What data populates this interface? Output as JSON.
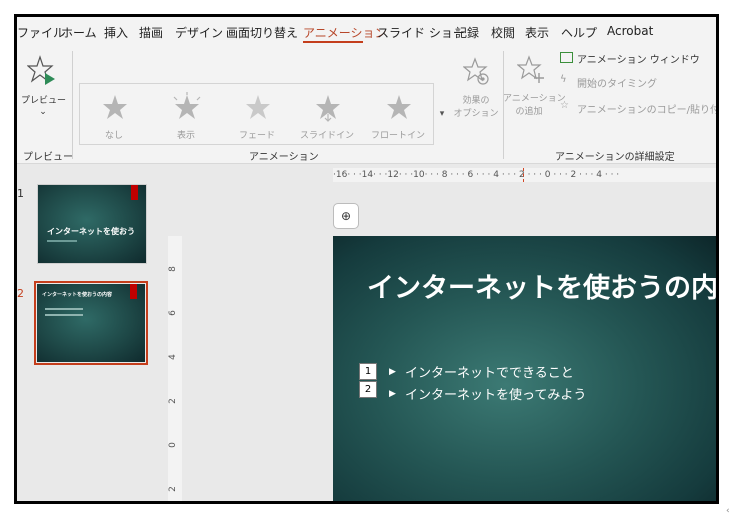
{
  "menu": {
    "items": [
      "ファイル",
      "ホーム",
      "挿入",
      "描画",
      "デザイン",
      "画面切り替え",
      "アニメーション",
      "スライド ショー",
      "記録",
      "校閲",
      "表示",
      "ヘルプ",
      "Acrobat"
    ],
    "active": "アニメーション"
  },
  "ribbon": {
    "preview": {
      "label": "プレビュー",
      "group": "プレビュー",
      "icon": "star-play-icon"
    },
    "animation_gallery": {
      "group": "アニメーション",
      "items": [
        {
          "label": "なし",
          "icon": "star-none-icon"
        },
        {
          "label": "表示",
          "icon": "star-appear-icon"
        },
        {
          "label": "フェード",
          "icon": "star-fade-icon"
        },
        {
          "label": "スライドイン",
          "icon": "star-slidein-icon"
        },
        {
          "label": "フロートイン",
          "icon": "star-floatin-icon"
        }
      ]
    },
    "effect_options": {
      "line1": "効果の",
      "line2": "オプション",
      "icon": "effect-options-icon"
    },
    "advanced": {
      "group": "アニメーションの詳細設定",
      "add_animation": {
        "line1": "アニメーション",
        "line2": "の追加"
      },
      "animation_pane": "アニメーション ウィンドウ",
      "trigger": "開始のタイミング",
      "painter": "アニメーションのコピー/貼り付け"
    }
  },
  "ruler": {
    "horizontal": "·16· · ·14· · ·12· · ·10· · · 8 · · · 6 · · · 4 · · · 2 · · · 0 · · · 2 · · · 4 · · ·",
    "vertical": [
      "8",
      "6",
      "4",
      "2",
      "0",
      "2"
    ]
  },
  "thumbnails": [
    {
      "number": "1",
      "title": "インターネットを使おう",
      "selected": false
    },
    {
      "number": "2",
      "title": "インターネットを使おうの内容",
      "selected": true
    }
  ],
  "slide": {
    "title": "インターネットを使おうの内容",
    "bullets": [
      {
        "tag": "1",
        "text": "インターネットでできること"
      },
      {
        "tag": "2",
        "text": "インターネットを使ってみよう"
      }
    ]
  },
  "colors": {
    "accent": "#c43e1c",
    "slide_bg": "#245654",
    "brand_red": "#c00000"
  },
  "misc": {
    "corner_glyph": "‹",
    "copilot_icon": "copilot-icon"
  }
}
